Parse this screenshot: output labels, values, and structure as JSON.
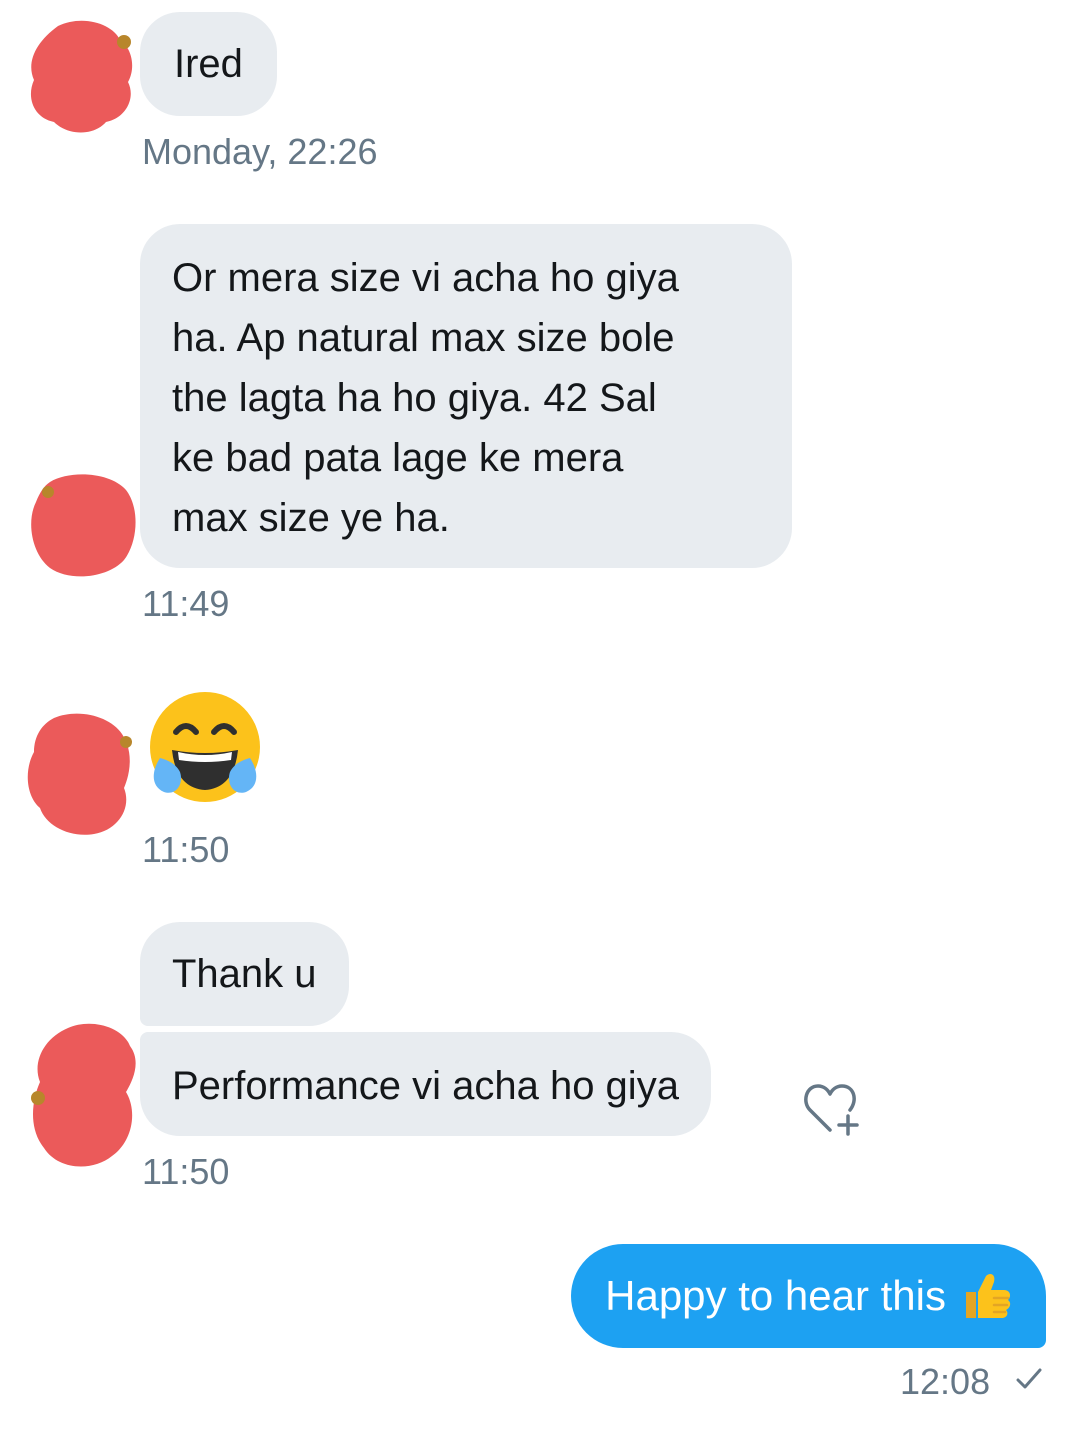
{
  "messages": {
    "m1": {
      "text": "Ired",
      "time": "Monday, 22:26"
    },
    "m2": {
      "lines": [
        "Or mera size vi acha ho giya",
        "ha. Ap natural max size bole",
        "the lagta ha ho giya. 42 Sal",
        "ke bad pata lage ke mera",
        "max size ye ha."
      ],
      "time": "11:49"
    },
    "m3": {
      "emoji": "face-with-tears-of-joy-icon",
      "time": "11:50"
    },
    "m4": {
      "text": "Thank u"
    },
    "m5": {
      "text": "Performance vi acha ho giya",
      "time": "11:50"
    },
    "m6": {
      "text": "Happy to hear this",
      "emoji": "thumbs-up-icon",
      "time": "12:08",
      "status": "sent-check-icon"
    }
  },
  "colors": {
    "incoming_bubble": "#e8ecf0",
    "outgoing_bubble": "#1da1f2",
    "timestamp": "#657786",
    "redaction": "#eb5a5a"
  }
}
